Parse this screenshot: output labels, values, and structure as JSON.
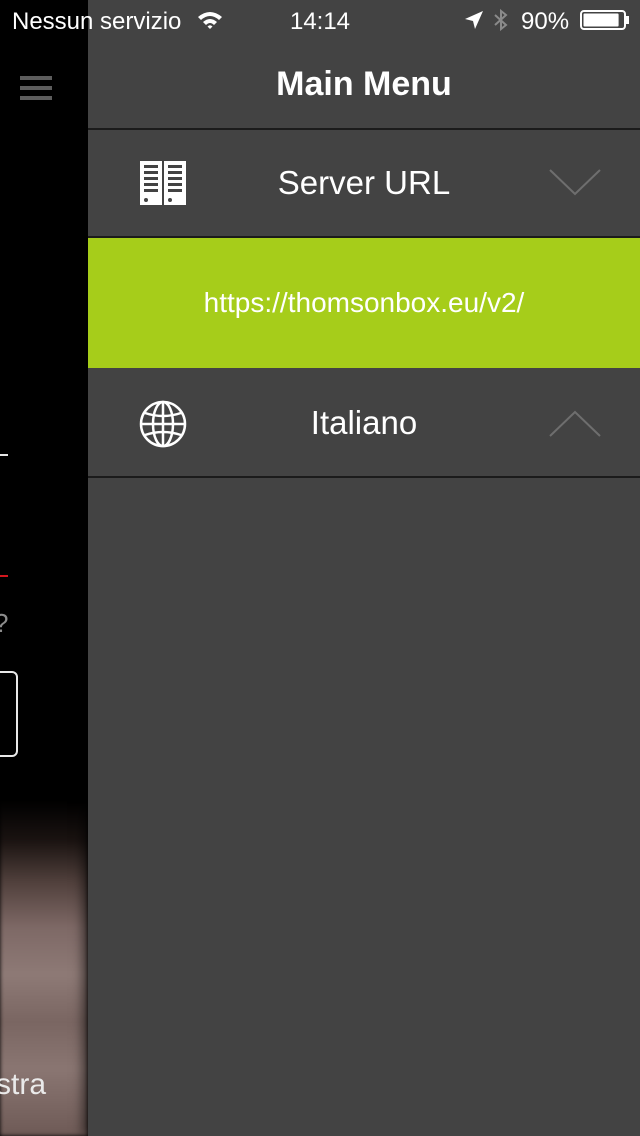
{
  "status_bar": {
    "carrier": "Nessun servizio",
    "time": "14:14",
    "battery": "90%",
    "battery_level": 0.9
  },
  "background_view": {
    "question_fragment": "?",
    "text_fragment": "stra"
  },
  "menu": {
    "title": "Main Menu",
    "items": [
      {
        "label": "Server URL",
        "icon": "server-icon",
        "chevron": "chevron-down-icon"
      },
      {
        "label": "Italiano",
        "icon": "globe-icon",
        "chevron": "chevron-up-icon"
      }
    ],
    "server_url": "https://thomsonbox.eu/v2/"
  },
  "colors": {
    "panel_bg": "#434343",
    "accent_green": "#a6cd1a",
    "separator": "#1b1b1b"
  }
}
